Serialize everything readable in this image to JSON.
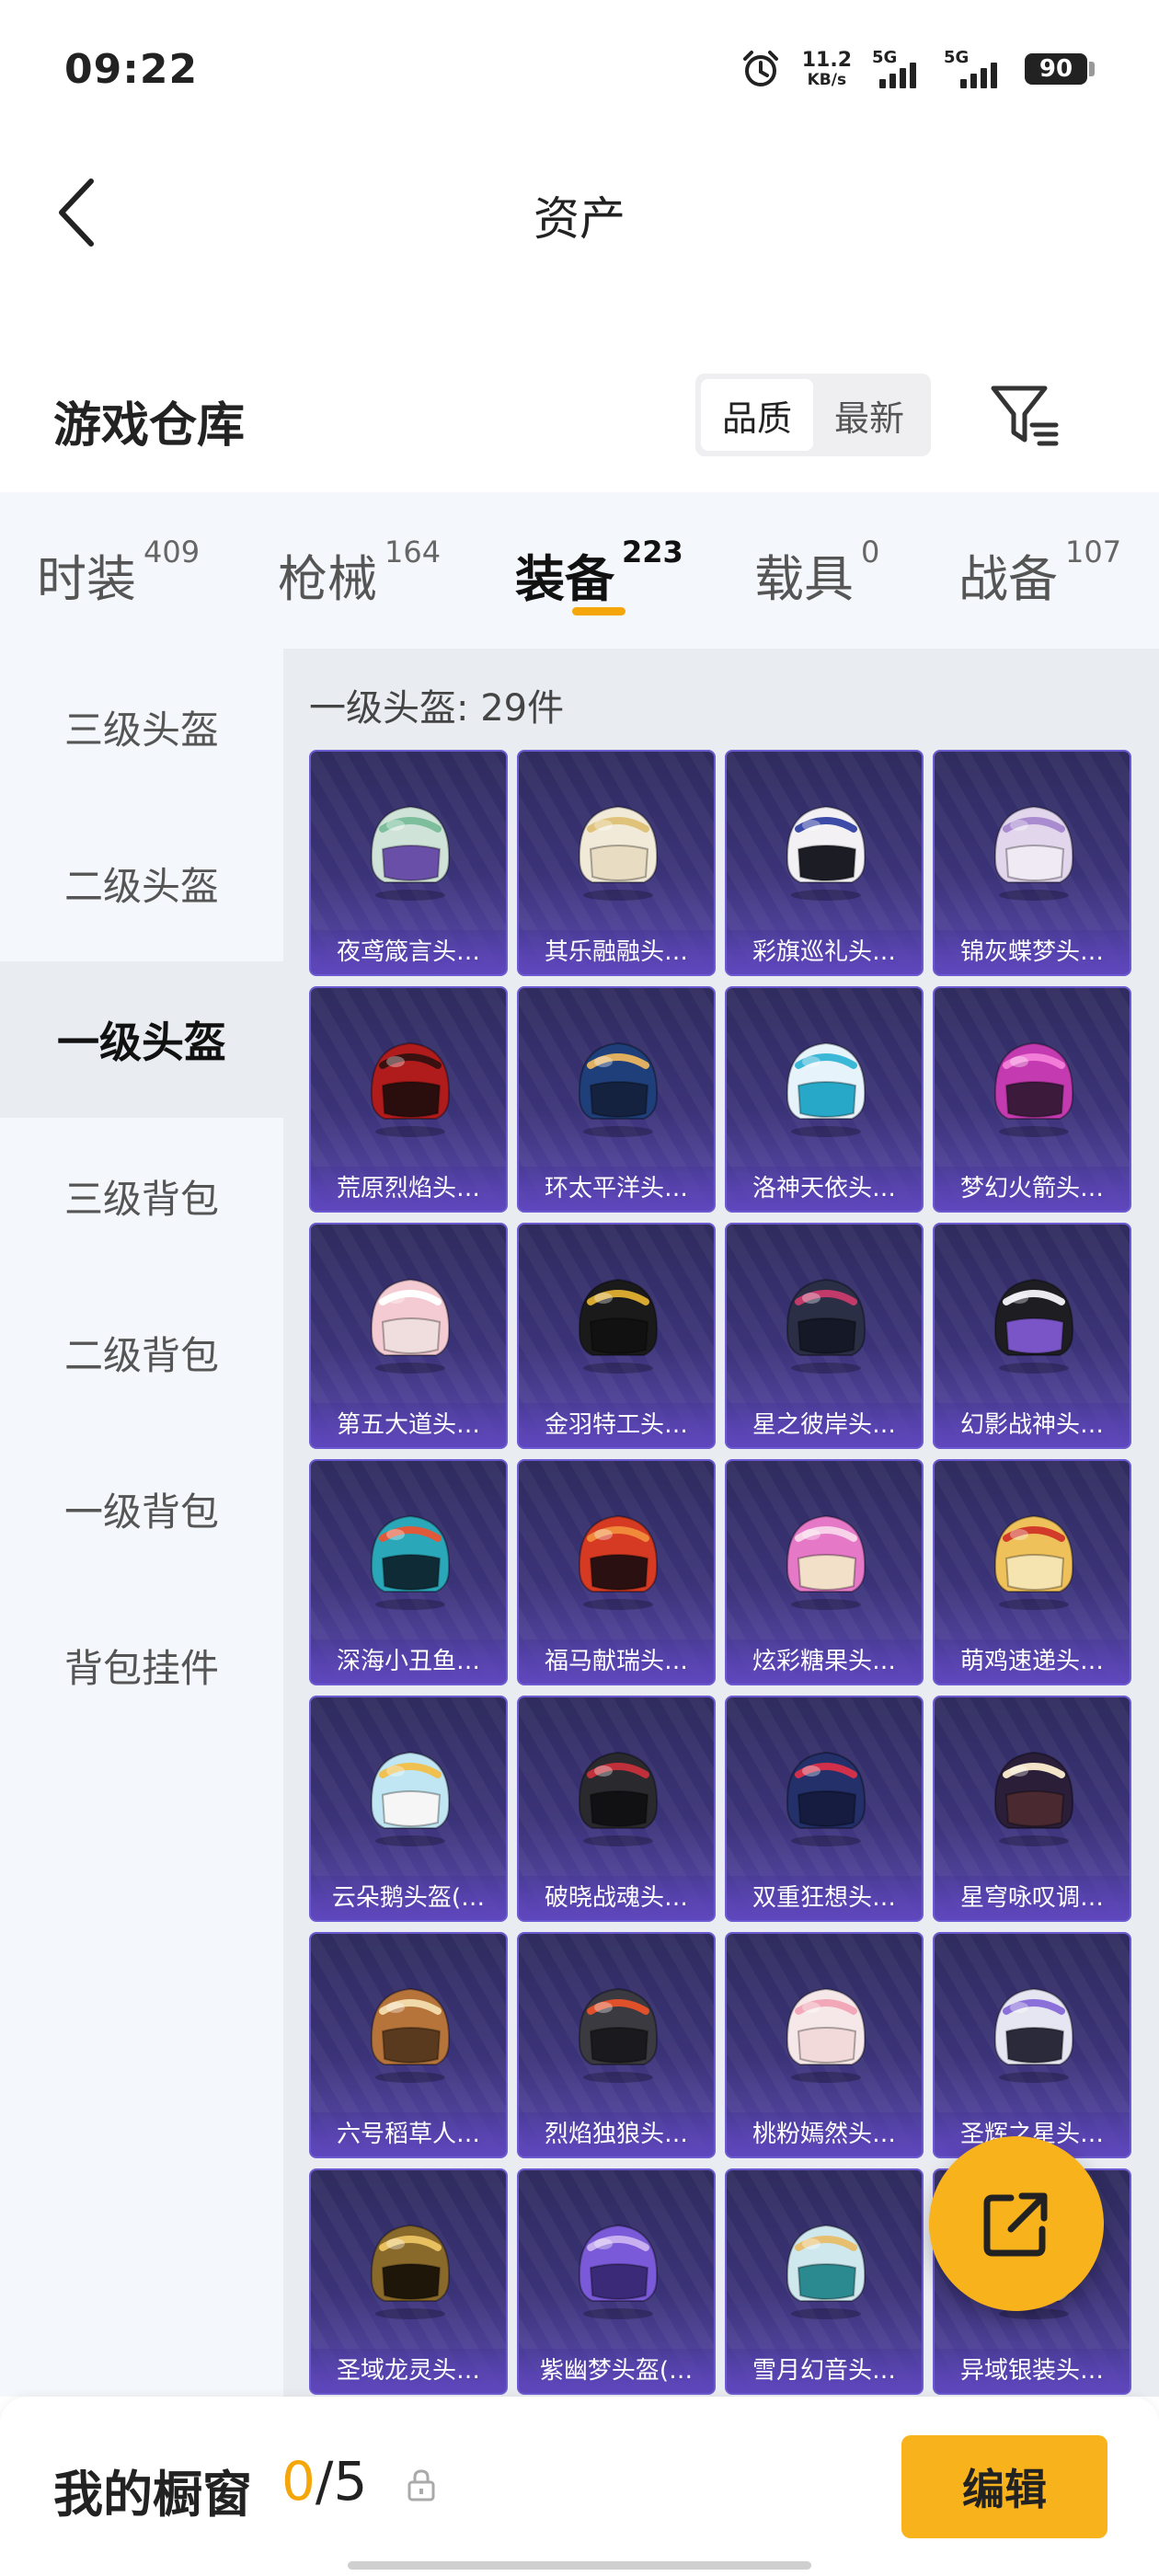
{
  "status_bar": {
    "time": "09:22",
    "net_speed_value": "11.2",
    "net_speed_unit": "KB/s",
    "sim1_label": "5G",
    "sim2_label": "5G",
    "battery": "90"
  },
  "header": {
    "title": "资产",
    "back_icon": "chevron-left-icon"
  },
  "warehouse": {
    "title": "游戏仓库",
    "sort_options": [
      "品质",
      "最新"
    ],
    "sort_selected": "品质",
    "filter_icon": "filter-icon"
  },
  "categories": [
    {
      "name": "时装",
      "count": "409"
    },
    {
      "name": "枪械",
      "count": "164"
    },
    {
      "name": "装备",
      "count": "223",
      "active": true
    },
    {
      "name": "载具",
      "count": "0"
    },
    {
      "name": "战备",
      "count": "107"
    }
  ],
  "sidebar": {
    "items": [
      "三级头盔",
      "二级头盔",
      "一级头盔",
      "三级背包",
      "二级背包",
      "一级背包",
      "背包挂件"
    ],
    "selected": "一级头盔"
  },
  "section": {
    "label": "一级头盔: 29件"
  },
  "items": [
    {
      "name": "夜鸢箴言头…",
      "base": "#cfe3d8",
      "accent": "#7dbf9d",
      "visor": "#6a4fa8"
    },
    {
      "name": "其乐融融头…",
      "base": "#f1ead8",
      "accent": "#e0c37a",
      "visor": "#e8dcc2"
    },
    {
      "name": "彩旗巡礼头…",
      "base": "#f3f1f4",
      "accent": "#3c4aa8",
      "visor": "#1c1c24"
    },
    {
      "name": "锦灰蝶梦头…",
      "base": "#e2d6ec",
      "accent": "#a98bd0",
      "visor": "#f0eaf4"
    },
    {
      "name": "荒原烈焰头…",
      "base": "#b01c1c",
      "accent": "#3a1010",
      "visor": "#2a0e0e"
    },
    {
      "name": "环太平洋头…",
      "base": "#1f3f7a",
      "accent": "#e0b060",
      "visor": "#15223f"
    },
    {
      "name": "洛神天依头…",
      "base": "#e6f3fa",
      "accent": "#3bb7d8",
      "visor": "#28a8c8"
    },
    {
      "name": "梦幻火箭头…",
      "base": "#c43ab0",
      "accent": "#f27dd8",
      "visor": "#3b1a3c"
    },
    {
      "name": "第五大道头…",
      "base": "#f4cbd2",
      "accent": "#ffffff",
      "visor": "#f0dede"
    },
    {
      "name": "金羽特工头…",
      "base": "#1a1a1a",
      "accent": "#d6a830",
      "visor": "#111111"
    },
    {
      "name": "星之彼岸头…",
      "base": "#2b2f45",
      "accent": "#c23a6a",
      "visor": "#151826"
    },
    {
      "name": "幻影战神头…",
      "base": "#1e1e22",
      "accent": "#e9e9ee",
      "visor": "#7a55c8"
    },
    {
      "name": "深海小丑鱼…",
      "base": "#2aa7b9",
      "accent": "#e05a3a",
      "visor": "#0f2b36"
    },
    {
      "name": "福马献瑞头…",
      "base": "#d63a22",
      "accent": "#f08a3a",
      "visor": "#2a1010"
    },
    {
      "name": "炫彩糖果头…",
      "base": "#e678c8",
      "accent": "#f7d2e8",
      "visor": "#f3e0c8"
    },
    {
      "name": "萌鸡速递头…",
      "base": "#efc15a",
      "accent": "#d23b2a",
      "visor": "#f6e4b0"
    },
    {
      "name": "云朵鹅头盔(…",
      "base": "#bfe6f2",
      "accent": "#f0c050",
      "visor": "#f6f6f6"
    },
    {
      "name": "破晓战魂头…",
      "base": "#2a2a2e",
      "accent": "#c0303a",
      "visor": "#111114"
    },
    {
      "name": "双重狂想头…",
      "base": "#23306a",
      "accent": "#d2304a",
      "visor": "#151c40"
    },
    {
      "name": "星穹咏叹调…",
      "base": "#2a1e38",
      "accent": "#f3e3c8",
      "visor": "#4a2a30"
    },
    {
      "name": "六号稻草人…",
      "base": "#b7743a",
      "accent": "#f0d8a8",
      "visor": "#5a3a1e"
    },
    {
      "name": "烈焰独狼头…",
      "base": "#3a3a40",
      "accent": "#e0502a",
      "visor": "#1a1a1e"
    },
    {
      "name": "桃粉嫣然头…",
      "base": "#f6e8e8",
      "accent": "#f2a8b8",
      "visor": "#f3dada"
    },
    {
      "name": "圣辉之星头…",
      "base": "#e6e6f2",
      "accent": "#8a70d8",
      "visor": "#2a2a3a"
    },
    {
      "name": "圣域龙灵头…",
      "base": "#8a6a2a",
      "accent": "#e8c060",
      "visor": "#1e1608"
    },
    {
      "name": "紫幽梦头盔(…",
      "base": "#7a5ad8",
      "accent": "#c8b0f0",
      "visor": "#3a2a78"
    },
    {
      "name": "雪月幻音头…",
      "base": "#cfe8ee",
      "accent": "#e6c070",
      "visor": "#2a8a90"
    },
    {
      "name": "异域银装头…",
      "base": "#d8d8de",
      "accent": "#a0a0b0",
      "visor": "#3a3a48"
    }
  ],
  "fab": {
    "icon": "share-external-icon"
  },
  "bottom_bar": {
    "title": "我的橱窗",
    "count_current": "0",
    "count_total": "/5",
    "lock_icon": "lock-icon",
    "edit_label": "编辑"
  },
  "colors": {
    "accent": "#f8b21c",
    "card_bg": "#3b3378",
    "card_border": "#6c5ad0"
  }
}
